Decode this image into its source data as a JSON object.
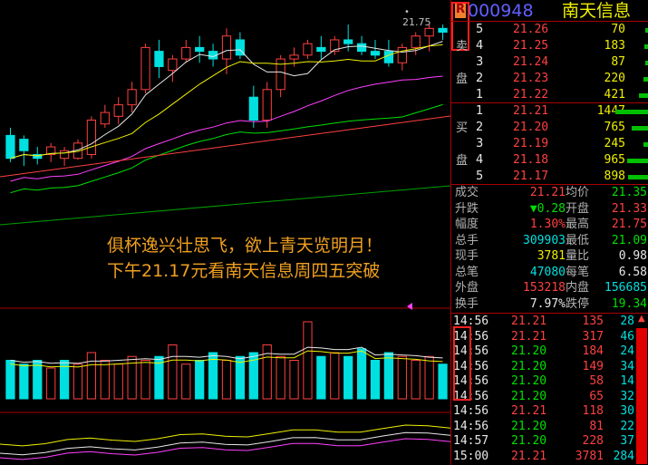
{
  "header": {
    "badge": "R",
    "code": "000948",
    "name": "南天信息"
  },
  "price_label": "21.75",
  "caption": {
    "line1": "俱杯逸兴壮思飞，欲上青天览明月！",
    "line2": "下午21.17元看南天信息周四五突破"
  },
  "sell_side_label": [
    "卖",
    "盘"
  ],
  "buy_side_label": [
    "买",
    "盘"
  ],
  "sell_orders": [
    {
      "level": "5",
      "price": "21.26",
      "volume": "70"
    },
    {
      "level": "4",
      "price": "21.25",
      "volume": "183"
    },
    {
      "level": "3",
      "price": "21.24",
      "volume": "87"
    },
    {
      "level": "2",
      "price": "21.23",
      "volume": "220"
    },
    {
      "level": "1",
      "price": "21.22",
      "volume": "421"
    }
  ],
  "buy_orders": [
    {
      "level": "1",
      "price": "21.21",
      "volume": "1447"
    },
    {
      "level": "2",
      "price": "21.20",
      "volume": "765"
    },
    {
      "level": "3",
      "price": "21.19",
      "volume": "245"
    },
    {
      "level": "4",
      "price": "21.18",
      "volume": "965"
    },
    {
      "level": "5",
      "price": "21.17",
      "volume": "898"
    }
  ],
  "stats": [
    {
      "l1": "成交",
      "v1": "21.21",
      "l2": "均价",
      "v2": "21.35"
    },
    {
      "l1": "升跌",
      "v1": "▼0.28",
      "l2": "开盘",
      "v2": "21.33"
    },
    {
      "l1": "幅度",
      "v1": "1.30%",
      "l2": "最高",
      "v2": "21.75"
    },
    {
      "l1": "总手",
      "v1": "309903",
      "l2": "最低",
      "v2": "21.09"
    },
    {
      "l1": "现手",
      "v1": "3781",
      "l2": "量比",
      "v2": "0.98"
    },
    {
      "l1": "总笔",
      "v1": "47080",
      "l2": "每笔",
      "v2": "6.58"
    },
    {
      "l1": "外盘",
      "v1": "153218",
      "l2": "内盘",
      "v2": "156685"
    },
    {
      "l1": "换手",
      "v1": "7.97%",
      "l2": "跌停",
      "v2": "19.34"
    }
  ],
  "ticks": [
    {
      "time": "14:56",
      "price": "21.21",
      "vol": "135",
      "num": "28"
    },
    {
      "time": "14:56",
      "price": "21.21",
      "vol": "317",
      "num": "46"
    },
    {
      "time": "14:56",
      "price": "21.20",
      "vol": "184",
      "num": "24"
    },
    {
      "time": "14:56",
      "price": "21.20",
      "vol": "149",
      "num": "34"
    },
    {
      "time": "14:56",
      "price": "21.20",
      "vol": "58",
      "num": "14"
    },
    {
      "time": "14:56",
      "price": "21.20",
      "vol": "65",
      "num": "32"
    },
    {
      "time": "14:56",
      "price": "21.21",
      "vol": "118",
      "num": "30"
    },
    {
      "time": "14:56",
      "price": "21.20",
      "vol": "81",
      "num": "22"
    },
    {
      "time": "14:57",
      "price": "21.20",
      "vol": "228",
      "num": "37"
    },
    {
      "time": "15:00",
      "price": "21.21",
      "vol": "3781",
      "num": "284"
    }
  ],
  "chart_data": {
    "type": "candlestick",
    "candles": [
      {
        "o": 20.3,
        "h": 20.4,
        "l": 19.95,
        "c": 20.0
      },
      {
        "o": 20.25,
        "h": 20.3,
        "l": 19.9,
        "c": 20.1
      },
      {
        "o": 20.05,
        "h": 20.15,
        "l": 19.92,
        "c": 20.0
      },
      {
        "o": 20.05,
        "h": 20.2,
        "l": 19.95,
        "c": 20.15
      },
      {
        "o": 20.0,
        "h": 20.15,
        "l": 19.9,
        "c": 20.1
      },
      {
        "o": 20.0,
        "h": 20.25,
        "l": 19.98,
        "c": 20.2
      },
      {
        "o": 20.05,
        "h": 20.55,
        "l": 20.0,
        "c": 20.5
      },
      {
        "o": 20.45,
        "h": 20.7,
        "l": 20.4,
        "c": 20.6
      },
      {
        "o": 20.55,
        "h": 20.8,
        "l": 20.45,
        "c": 20.7
      },
      {
        "o": 20.7,
        "h": 21.0,
        "l": 20.6,
        "c": 20.9
      },
      {
        "o": 20.9,
        "h": 21.5,
        "l": 20.85,
        "c": 21.45
      },
      {
        "o": 21.4,
        "h": 21.55,
        "l": 21.05,
        "c": 21.2
      },
      {
        "o": 21.15,
        "h": 21.35,
        "l": 21.0,
        "c": 21.3
      },
      {
        "o": 21.3,
        "h": 21.55,
        "l": 21.25,
        "c": 21.45
      },
      {
        "o": 21.45,
        "h": 21.6,
        "l": 21.25,
        "c": 21.4
      },
      {
        "o": 21.4,
        "h": 21.5,
        "l": 21.2,
        "c": 21.3
      },
      {
        "o": 21.3,
        "h": 21.7,
        "l": 21.1,
        "c": 21.6
      },
      {
        "o": 21.55,
        "h": 21.65,
        "l": 21.3,
        "c": 21.35
      },
      {
        "o": 20.8,
        "h": 20.95,
        "l": 20.4,
        "c": 20.5
      },
      {
        "o": 20.5,
        "h": 21.0,
        "l": 20.4,
        "c": 20.9
      },
      {
        "o": 20.9,
        "h": 21.35,
        "l": 20.8,
        "c": 21.3
      },
      {
        "o": 21.3,
        "h": 21.45,
        "l": 21.2,
        "c": 21.35
      },
      {
        "o": 21.35,
        "h": 21.55,
        "l": 21.3,
        "c": 21.5
      },
      {
        "o": 21.45,
        "h": 21.6,
        "l": 21.3,
        "c": 21.4
      },
      {
        "o": 21.4,
        "h": 21.6,
        "l": 21.35,
        "c": 21.55
      },
      {
        "o": 21.55,
        "h": 21.75,
        "l": 21.4,
        "c": 21.5
      },
      {
        "o": 21.5,
        "h": 21.6,
        "l": 21.35,
        "c": 21.4
      },
      {
        "o": 21.4,
        "h": 21.55,
        "l": 21.3,
        "c": 21.35
      },
      {
        "o": 21.4,
        "h": 21.55,
        "l": 21.2,
        "c": 21.25
      },
      {
        "o": 21.25,
        "h": 21.5,
        "l": 21.15,
        "c": 21.45
      },
      {
        "o": 21.45,
        "h": 21.65,
        "l": 21.35,
        "c": 21.6
      },
      {
        "o": 21.6,
        "h": 21.75,
        "l": 21.4,
        "c": 21.7
      },
      {
        "o": 21.7,
        "h": 21.75,
        "l": 21.55,
        "c": 21.65
      }
    ],
    "volumes": [
      0.5,
      0.45,
      0.5,
      0.4,
      0.5,
      0.45,
      0.6,
      0.5,
      0.45,
      0.55,
      0.5,
      0.55,
      0.7,
      0.45,
      0.5,
      0.6,
      0.5,
      0.55,
      0.6,
      0.7,
      0.55,
      0.5,
      1.0,
      0.55,
      0.6,
      0.55,
      0.65,
      0.5,
      0.6,
      0.55,
      0.5,
      0.55,
      0.45
    ],
    "volume_up": [
      false,
      false,
      false,
      true,
      false,
      true,
      true,
      true,
      true,
      true,
      true,
      false,
      true,
      true,
      false,
      false,
      true,
      false,
      false,
      true,
      true,
      true,
      true,
      false,
      true,
      false,
      false,
      false,
      false,
      true,
      true,
      true,
      false
    ],
    "colors": {
      "up": "#ff4040",
      "down": "#00e0e0",
      "ma5": "#e8e8e8",
      "ma10": "#f0f000",
      "ma20": "#ff40ff",
      "ma30": "#00e000",
      "ma60": "#ff4040",
      "ma120": "#00a000"
    }
  }
}
